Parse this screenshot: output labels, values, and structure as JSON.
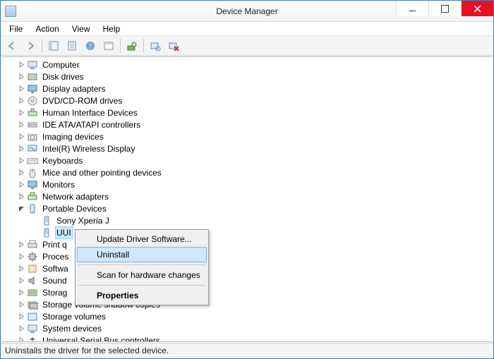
{
  "window": {
    "title": "Device Manager"
  },
  "menubar": {
    "file": "File",
    "action": "Action",
    "view": "View",
    "help": "Help"
  },
  "tree": {
    "items": [
      {
        "label": "Computer",
        "expanded": false
      },
      {
        "label": "Disk drives",
        "expanded": false
      },
      {
        "label": "Display adapters",
        "expanded": false
      },
      {
        "label": "DVD/CD-ROM drives",
        "expanded": false
      },
      {
        "label": "Human Interface Devices",
        "expanded": false
      },
      {
        "label": "IDE ATA/ATAPI controllers",
        "expanded": false
      },
      {
        "label": "Imaging devices",
        "expanded": false
      },
      {
        "label": "Intel(R) Wireless Display",
        "expanded": false
      },
      {
        "label": "Keyboards",
        "expanded": false
      },
      {
        "label": "Mice and other pointing devices",
        "expanded": false
      },
      {
        "label": "Monitors",
        "expanded": false
      },
      {
        "label": "Network adapters",
        "expanded": false
      },
      {
        "label": "Portable Devices",
        "expanded": true,
        "children": [
          {
            "label": "Sony Xperia J"
          },
          {
            "label": "UUI",
            "selected": true
          }
        ]
      },
      {
        "label": "Print q",
        "truncated": true,
        "expanded": false
      },
      {
        "label": "Proces",
        "truncated": true,
        "expanded": false
      },
      {
        "label": "Softwa",
        "truncated": true,
        "expanded": false
      },
      {
        "label": "Sound",
        "truncated": true,
        "expanded": false
      },
      {
        "label": "Storag",
        "truncated": true,
        "expanded": false
      },
      {
        "label": "Storage volume shadow copies",
        "expanded": false
      },
      {
        "label": "Storage volumes",
        "expanded": false
      },
      {
        "label": "System devices",
        "expanded": false
      },
      {
        "label": "Universal Serial Bus controllers",
        "expanded": false
      }
    ]
  },
  "contextmenu": {
    "update": "Update Driver Software...",
    "uninstall": "Uninstall",
    "scan": "Scan for hardware changes",
    "properties": "Properties"
  },
  "statusbar": {
    "text": "Uninstalls the driver for the selected device."
  }
}
